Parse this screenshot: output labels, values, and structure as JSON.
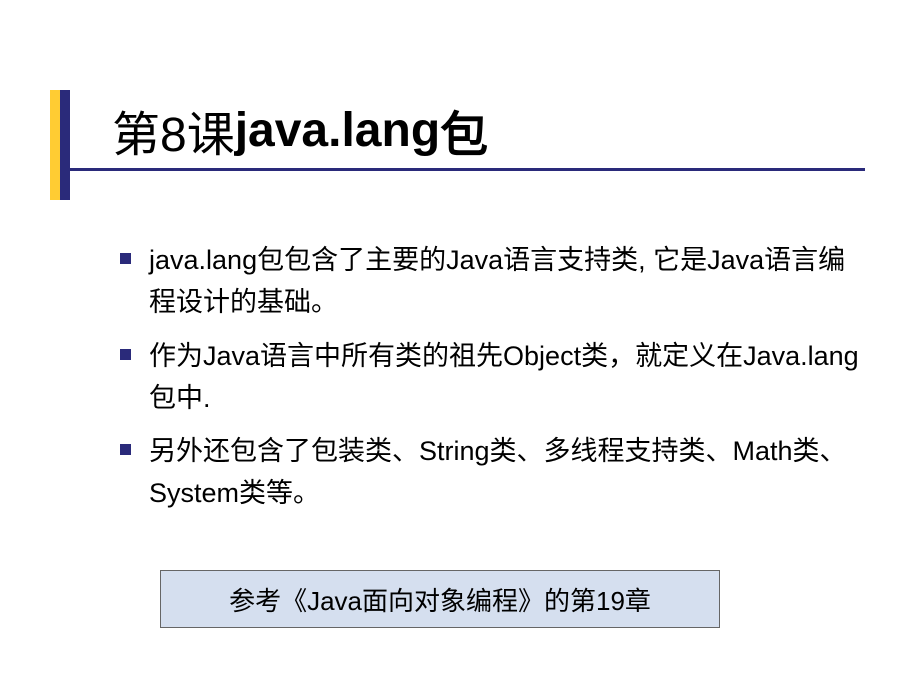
{
  "title": {
    "prefix": "第8课 ",
    "main": "java.lang ",
    "suffix": "包"
  },
  "bullets": [
    "java.lang包包含了主要的Java语言支持类, 它是Java语言编程设计的基础。",
    "作为Java语言中所有类的祖先Object类，就定义在Java.lang包中.",
    "另外还包含了包装类、String类、多线程支持类、Math类、System类等。"
  ],
  "reference": "参考《Java面向对象编程》的第19章"
}
